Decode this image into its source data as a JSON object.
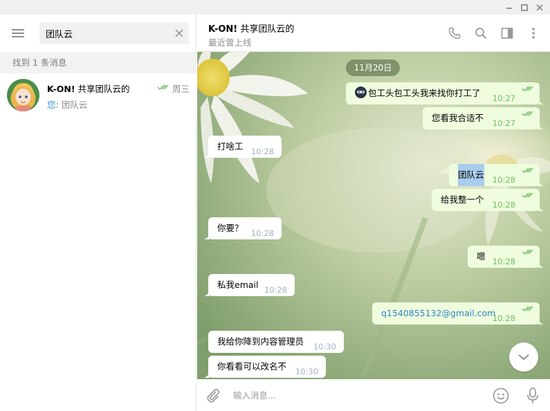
{
  "window": {
    "minimize_icon": "minimize-icon",
    "maximize_icon": "maximize-icon",
    "close_icon": "close-icon"
  },
  "sidebar": {
    "search": {
      "value": "团队云",
      "placeholder": ""
    },
    "found_label": "找到 1 条消息",
    "dialog": {
      "name_bold": "K-ON!",
      "name_rest": " 共享团队云的",
      "time": "周三",
      "preview_prefix": "您:",
      "preview_text": " 团队云"
    }
  },
  "chat": {
    "title_bold": "K-ON!",
    "title_rest": " 共享团队云的",
    "status": "最近曾上线",
    "date": "11月20日",
    "messages": [
      {
        "dir": "out",
        "text": "包工头包工头我来找你打工了",
        "time": "10:27",
        "emoji": true
      },
      {
        "dir": "out",
        "text": "您看我合适不",
        "time": "10:27"
      },
      {
        "dir": "in",
        "text": "打啥工",
        "time": "10:28"
      },
      {
        "dir": "out",
        "text": "团队云",
        "time": "10:28",
        "highlight": true
      },
      {
        "dir": "out",
        "text": "给我整一个",
        "time": "10:28"
      },
      {
        "dir": "in",
        "text": "你要？",
        "time": "10:28"
      },
      {
        "dir": "out",
        "text": "嗯",
        "time": "10:28"
      },
      {
        "dir": "in",
        "text": "私我email",
        "time": "10:28"
      },
      {
        "dir": "out",
        "text": "q1540855132@gmail.com",
        "time": "10:28",
        "link": true
      },
      {
        "dir": "in",
        "text": "我给你降到内容管理员",
        "time": "10:30"
      },
      {
        "dir": "in",
        "text": "你看看可以改名不",
        "time": "10:30"
      }
    ],
    "composer_placeholder": "输入消息..."
  },
  "colors": {
    "accent": "#3a8fcf",
    "out_bubble": "#effdde",
    "in_bubble": "#ffffff",
    "check_green": "#6cbf61"
  }
}
